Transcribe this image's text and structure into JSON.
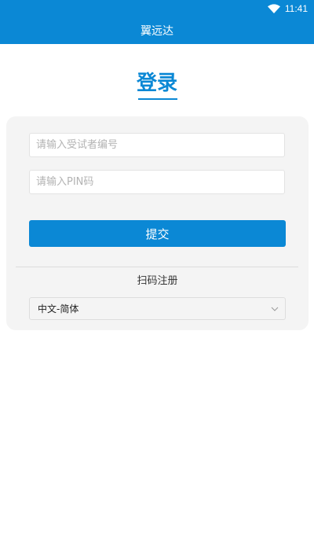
{
  "status_bar": {
    "time": "11:41",
    "icons": [
      "wifi-icon"
    ]
  },
  "app_bar": {
    "title": "翼远达"
  },
  "login": {
    "title": "登录",
    "subject_id_placeholder": "请输入受试者编号",
    "pin_placeholder": "请输入PIN码",
    "submit_label": "提交",
    "scan_register_label": "扫码注册",
    "language": {
      "selected": "中文-简体"
    }
  },
  "colors": {
    "primary": "#0b88d5",
    "card_background": "#f4f4f4"
  }
}
